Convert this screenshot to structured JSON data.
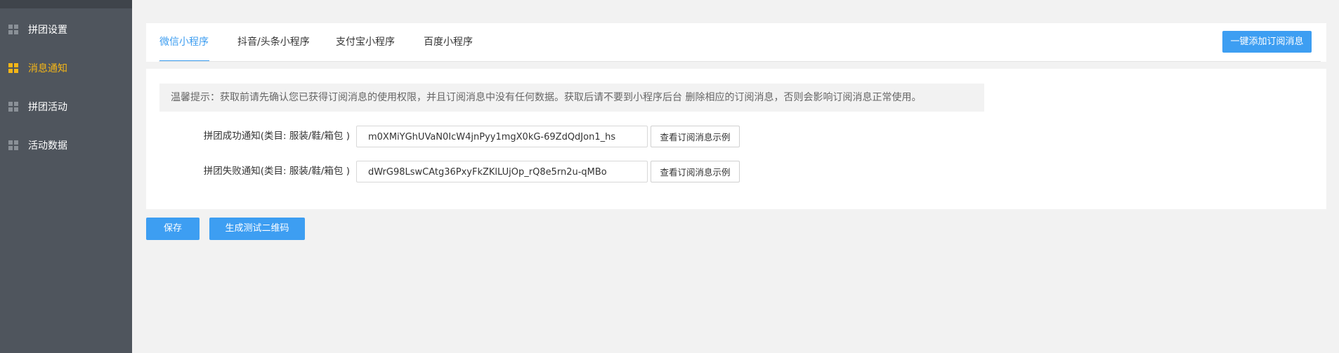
{
  "sidebar": {
    "items": [
      {
        "label": "拼团设置",
        "icon": "grid-icon",
        "active": false
      },
      {
        "label": "消息通知",
        "icon": "grid-icon",
        "active": true
      },
      {
        "label": "拼团活动",
        "icon": "grid-icon",
        "active": false
      },
      {
        "label": "活动数据",
        "icon": "grid-icon",
        "active": false
      }
    ],
    "active_color": "#f5b617"
  },
  "tabs": {
    "items": [
      {
        "label": "微信小程序",
        "active": true
      },
      {
        "label": "抖音/头条小程序",
        "active": false
      },
      {
        "label": "支付宝小程序",
        "active": false
      },
      {
        "label": "百度小程序",
        "active": false
      }
    ],
    "add_button_label": "一键添加订阅消息"
  },
  "form": {
    "tip": "温馨提示：获取前请先确认您已获得订阅消息的使用权限，并且订阅消息中没有任何数据。获取后请不要到小程序后台 删除相应的订阅消息，否则会影响订阅消息正常使用。",
    "rows": [
      {
        "label": "拼团成功通知(类目: 服装/鞋/箱包 )",
        "value": "m0XMiYGhUVaN0IcW4jnPyy1mgX0kG-69ZdQdJon1_hs",
        "button_label": "查看订阅消息示例"
      },
      {
        "label": "拼团失败通知(类目: 服装/鞋/箱包 )",
        "value": "dWrG98LswCAtg36PxyFkZKlLUjOp_rQ8e5rn2u-qMBo",
        "button_label": "查看订阅消息示例"
      }
    ]
  },
  "footer": {
    "save_label": "保存",
    "qrcode_label": "生成测试二维码"
  },
  "colors": {
    "primary": "#3d9ef2",
    "sidebar_bg": "#4f555d"
  }
}
